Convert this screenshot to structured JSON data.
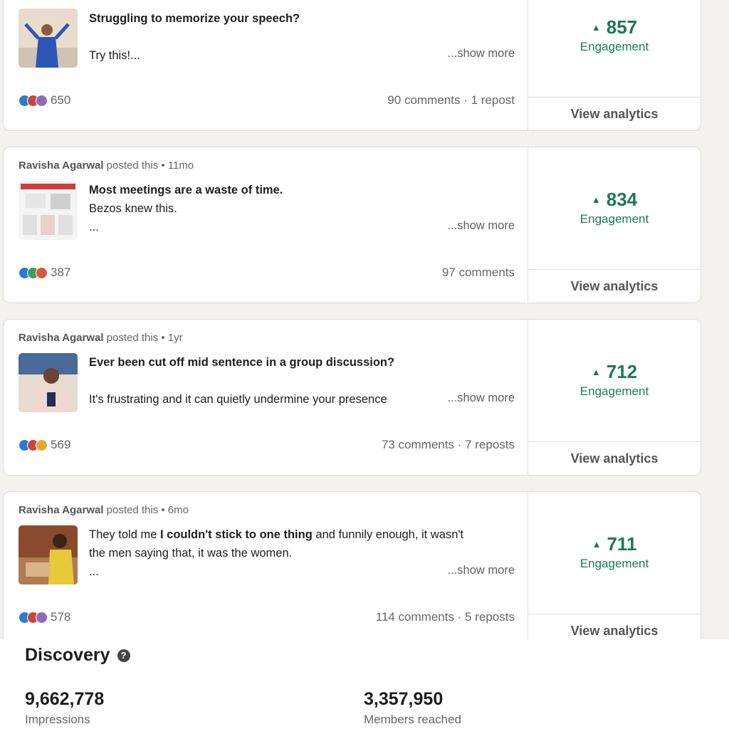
{
  "posts": [
    {
      "author": "",
      "meta": "",
      "lines": [
        [
          {
            "text": "Struggling to memorize your speech?",
            "bold": true
          }
        ],
        [
          {
            "text": "",
            "bold": false
          }
        ],
        [
          {
            "text": "Try this!...",
            "bold": false
          }
        ]
      ],
      "show_more": "...show more",
      "reaction_count": "650",
      "comments": "90 comments · 1 repost",
      "engagement": "857",
      "engagement_label": "Engagement",
      "analytics": "View analytics",
      "reaction_colors": [
        "#2b7bd1",
        "#c9463a",
        "#8e6bb8"
      ]
    },
    {
      "author": "Ravisha Agarwal",
      "meta": "posted this • 11mo",
      "lines": [
        [
          {
            "text": "Most meetings are a waste of time.",
            "bold": true
          }
        ],
        [
          {
            "text": "Bezos knew this.",
            "bold": false
          }
        ],
        [
          {
            "text": "...",
            "bold": false
          }
        ]
      ],
      "show_more": "...show more",
      "reaction_count": "387",
      "comments": "97 comments",
      "engagement": "834",
      "engagement_label": "Engagement",
      "analytics": "View analytics",
      "reaction_colors": [
        "#2b7bd1",
        "#3f9b5a",
        "#d8573b"
      ]
    },
    {
      "author": "Ravisha Agarwal",
      "meta": "posted this • 1yr",
      "lines": [
        [
          {
            "text": "Ever been cut off mid sentence in a group discussion?",
            "bold": true
          }
        ],
        [
          {
            "text": "",
            "bold": false
          }
        ],
        [
          {
            "text": "It's frustrating and it can quietly undermine your presence",
            "bold": false
          }
        ]
      ],
      "show_more": "...show more",
      "reaction_count": "569",
      "comments": "73 comments · 7 reposts",
      "engagement": "712",
      "engagement_label": "Engagement",
      "analytics": "View analytics",
      "reaction_colors": [
        "#2b7bd1",
        "#c9463a",
        "#e3a92e"
      ]
    },
    {
      "author": "Ravisha Agarwal",
      "meta": "posted this • 6mo",
      "lines": [
        [
          {
            "text": "They told me ",
            "bold": false
          },
          {
            "text": "I couldn't stick to one thing",
            "bold": true
          },
          {
            "text": " and funnily enough, it wasn't",
            "bold": false
          }
        ],
        [
          {
            "text": "the men saying that, it was the women.",
            "bold": false
          }
        ],
        [
          {
            "text": "...",
            "bold": false
          }
        ]
      ],
      "show_more": "...show more",
      "reaction_count": "578",
      "comments": "114 comments · 5 reposts",
      "engagement": "711",
      "engagement_label": "Engagement",
      "analytics": "View analytics",
      "reaction_colors": [
        "#2b7bd1",
        "#c9463a",
        "#8e6bb8"
      ]
    }
  ],
  "discovery": {
    "title": "Discovery",
    "help_icon": "?",
    "impressions_value": "9,662,778",
    "impressions_label": "Impressions",
    "members_value": "3,357,950",
    "members_label": "Members reached"
  },
  "colors": {
    "engagement_green": "#1a7a55",
    "page_bg": "#f3f2ef"
  }
}
